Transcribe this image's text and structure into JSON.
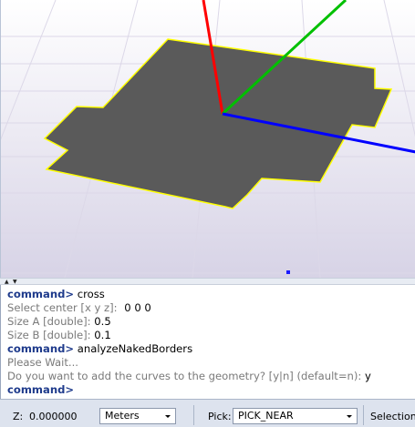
{
  "console": {
    "lines": [
      {
        "prompt": "command>",
        "text": "cross"
      },
      {
        "label": "Select center [x y z]:",
        "value": "0 0 0"
      },
      {
        "label": "Size A [double]:",
        "value": "0.5"
      },
      {
        "label": "Size B [double]:",
        "value": "0.1"
      },
      {
        "prompt": "command>",
        "text": "analyzeNakedBorders"
      },
      {
        "label": "Please Wait...",
        "value": ""
      },
      {
        "label": "Do you want to add the curves to the geometry? [y|n] (default=n):",
        "value": "y"
      },
      {
        "prompt": "command>",
        "text": ""
      }
    ]
  },
  "status": {
    "z_label": "Z:",
    "z_value": "0.000000",
    "units": "Meters",
    "pick_label": "Pick:",
    "pick_value": "PICK_NEAR",
    "selection_label": "Selection:"
  },
  "colors": {
    "x_axis": "#ff0000",
    "y_axis": "#00c000",
    "z_axis": "#0000ff",
    "surface": "#5a5a5a",
    "border": "#ffff00"
  }
}
